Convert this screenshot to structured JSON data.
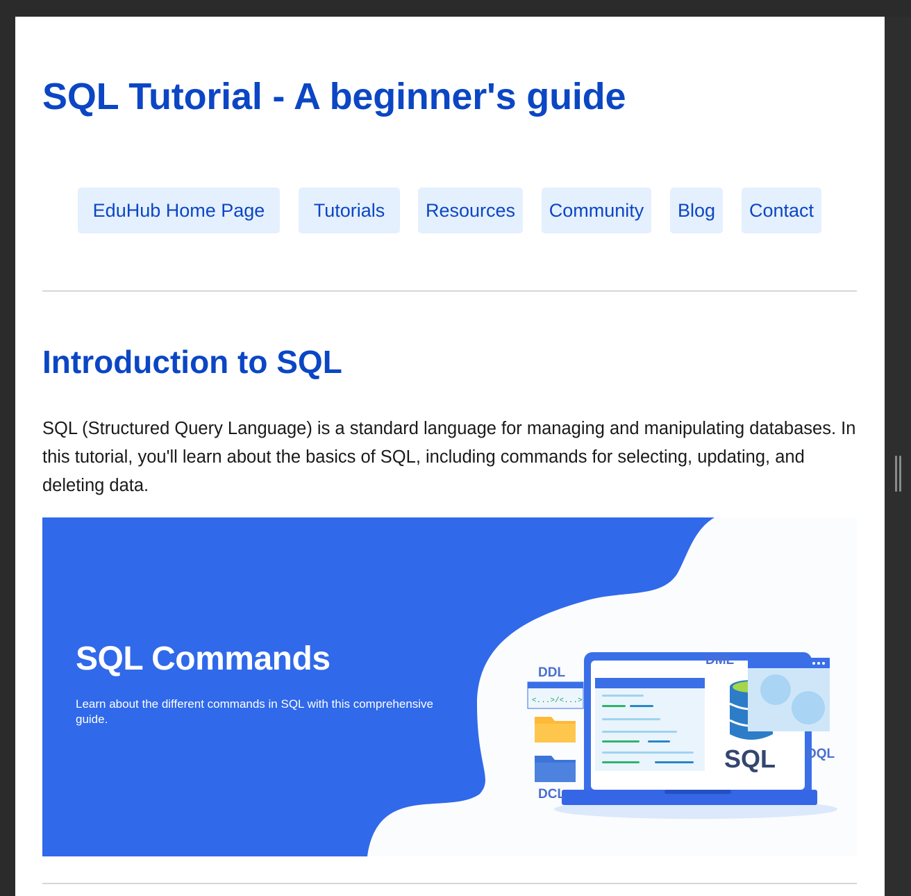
{
  "header": {
    "title": "SQL Tutorial - A beginner's guide"
  },
  "nav": {
    "items": [
      {
        "label": "EduHub Home Page"
      },
      {
        "label": "Tutorials"
      },
      {
        "label": "Resources"
      },
      {
        "label": "Community"
      },
      {
        "label": "Blog"
      },
      {
        "label": "Contact"
      }
    ]
  },
  "main": {
    "section_title": "Introduction to SQL",
    "intro_text": "SQL (Structured Query Language) is a standard language for managing and manipulating databases. In this tutorial, you'll learn about the basics of SQL, including commands for selecting, updating, and deleting data.",
    "banner": {
      "heading": "SQL Commands",
      "subtext": "Learn about the different commands in SQL with this comprehensive guide.",
      "labels": {
        "ddl": "DDL",
        "dml": "DML",
        "dql": "DQL",
        "dcl": "DCL",
        "sql": "SQL",
        "code_tag": "<...>/<...>"
      }
    }
  },
  "colors": {
    "brand_blue": "#0b46c4",
    "nav_bg": "#e5f0fe",
    "banner_blue": "#3069ea"
  }
}
